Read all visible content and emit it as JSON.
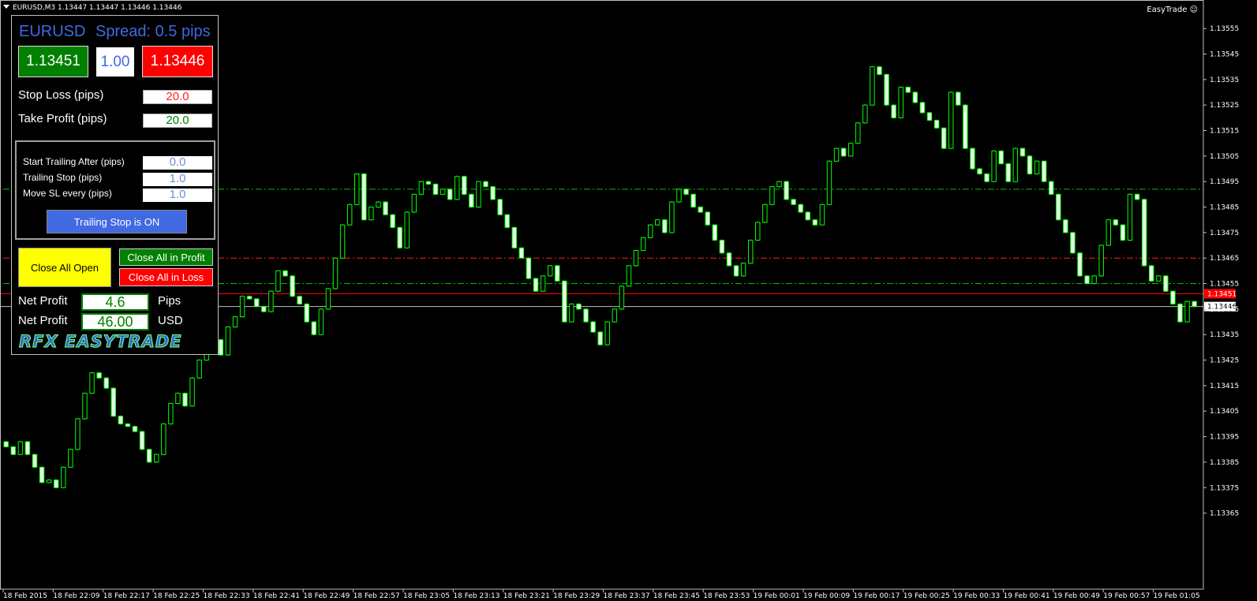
{
  "window": {
    "title": "EURUSD,M3  1.13447 1.13447 1.13446 1.13446",
    "ea_name": "EasyTrade",
    "ea_icon": "smiley-icon"
  },
  "panel": {
    "symbol": "EURUSD",
    "spread": "Spread: 0.5 pips",
    "buy_price": "1.13451",
    "lot": "1.00",
    "sell_price": "1.13446",
    "stop_loss_label": "Stop Loss (pips)",
    "stop_loss_value": "20.0",
    "take_profit_label": "Take Profit (pips)",
    "take_profit_value": "20.0",
    "trailing": {
      "start_label": "Start Trailing After (pips)",
      "start_value": "0.0",
      "stop_label": "Trailing Stop (pips)",
      "stop_value": "1.0",
      "move_label": "Move SL every (pips)",
      "move_value": "1.0",
      "button": "Trailing Stop is ON"
    },
    "close_all": "Close All Open",
    "close_profit": "Close All in Profit",
    "close_loss": "Close All in Loss",
    "net_profit_label": "Net Profit",
    "net_profit_pips": "4.6",
    "pips_unit": "Pips",
    "net_profit_usd": "46.00",
    "usd_unit": "USD",
    "logo": "RFX EASYTRADE"
  },
  "colors": {
    "background": "#000000",
    "bull": "#00ff00",
    "bear": "#e8ffe8",
    "ask_line": "#ff0000",
    "bid_line": "#c0c0c0",
    "tp_line": "#00c000",
    "sl_line": "#ff2020"
  },
  "chart_data": {
    "type": "candlestick",
    "symbol": "EURUSD",
    "timeframe": "M3",
    "y_ticks": [
      "1.13555",
      "1.13545",
      "1.13535",
      "1.13525",
      "1.13515",
      "1.13505",
      "1.13495",
      "1.13485",
      "1.13475",
      "1.13465",
      "1.13455",
      "1.13445",
      "1.13435",
      "1.13425",
      "1.13415",
      "1.13405",
      "1.13395",
      "1.13385",
      "1.13375",
      "1.13365"
    ],
    "ylim": [
      1.13359,
      1.1356
    ],
    "x_labels": [
      "18 Feb 2015",
      "18 Feb 22:09",
      "18 Feb 22:17",
      "18 Feb 22:25",
      "18 Feb 22:33",
      "18 Feb 22:41",
      "18 Feb 22:49",
      "18 Feb 22:57",
      "18 Feb 23:05",
      "18 Feb 23:13",
      "18 Feb 23:21",
      "18 Feb 23:29",
      "18 Feb 23:37",
      "18 Feb 23:45",
      "18 Feb 23:53",
      "19 Feb 00:01",
      "19 Feb 00:09",
      "19 Feb 00:17",
      "19 Feb 00:25",
      "19 Feb 00:33",
      "19 Feb 00:41",
      "19 Feb 00:49",
      "19 Feb 00:57",
      "19 Feb 01:05"
    ],
    "ask_price": "1.13451",
    "bid_price": "1.13446",
    "levels": [
      {
        "name": "tp-upper",
        "price": 1.13492,
        "style": "dashdot",
        "color": "#00c000"
      },
      {
        "name": "sl-red",
        "price": 1.13465,
        "style": "dashdot",
        "color": "#ff2020"
      },
      {
        "name": "tp-lower",
        "price": 1.13455,
        "style": "dashdot",
        "color": "#00c000"
      }
    ],
    "candles_close": [
      1.13391,
      1.13388,
      1.13393,
      1.13388,
      1.13383,
      1.13377,
      1.13378,
      1.13375,
      1.13383,
      1.1339,
      1.13402,
      1.13412,
      1.1342,
      1.13418,
      1.13414,
      1.13403,
      1.134,
      1.13399,
      1.13397,
      1.1339,
      1.13385,
      1.13388,
      1.134,
      1.13408,
      1.13412,
      1.13407,
      1.13418,
      1.13425,
      1.1343,
      1.13433,
      1.13427,
      1.13438,
      1.13442,
      1.1345,
      1.13449,
      1.13446,
      1.13444,
      1.13452,
      1.1346,
      1.13458,
      1.1345,
      1.13447,
      1.1344,
      1.13435,
      1.13445,
      1.13453,
      1.13465,
      1.13478,
      1.13486,
      1.13498,
      1.1348,
      1.13485,
      1.13487,
      1.13482,
      1.13477,
      1.13469,
      1.13483,
      1.1349,
      1.13495,
      1.13494,
      1.1349,
      1.13492,
      1.13488,
      1.13497,
      1.1349,
      1.13485,
      1.13495,
      1.13493,
      1.13488,
      1.13482,
      1.13477,
      1.13469,
      1.13465,
      1.13457,
      1.13452,
      1.13458,
      1.13462,
      1.13456,
      1.1344,
      1.13447,
      1.13445,
      1.1344,
      1.13436,
      1.13431,
      1.1344,
      1.13445,
      1.13454,
      1.13462,
      1.13468,
      1.13473,
      1.13478,
      1.1348,
      1.13475,
      1.13487,
      1.13492,
      1.1349,
      1.13485,
      1.13483,
      1.13478,
      1.13472,
      1.13467,
      1.13462,
      1.13458,
      1.13463,
      1.13472,
      1.13479,
      1.13486,
      1.13493,
      1.13495,
      1.13488,
      1.13486,
      1.13483,
      1.1348,
      1.13478,
      1.13486,
      1.13503,
      1.13508,
      1.13505,
      1.1351,
      1.13518,
      1.13525,
      1.1354,
      1.13537,
      1.13525,
      1.1352,
      1.13532,
      1.1353,
      1.13526,
      1.13522,
      1.13519,
      1.13516,
      1.13508,
      1.1353,
      1.13525,
      1.13508,
      1.135,
      1.13498,
      1.13495,
      1.13507,
      1.13502,
      1.13495,
      1.13508,
      1.13505,
      1.13498,
      1.13503,
      1.13495,
      1.1349,
      1.1348,
      1.13475,
      1.13467,
      1.13458,
      1.13455,
      1.13458,
      1.1347,
      1.1348,
      1.13478,
      1.13472,
      1.1349,
      1.13488,
      1.13462,
      1.13456,
      1.13458,
      1.13452,
      1.13447,
      1.1344,
      1.13448,
      1.13446
    ]
  }
}
